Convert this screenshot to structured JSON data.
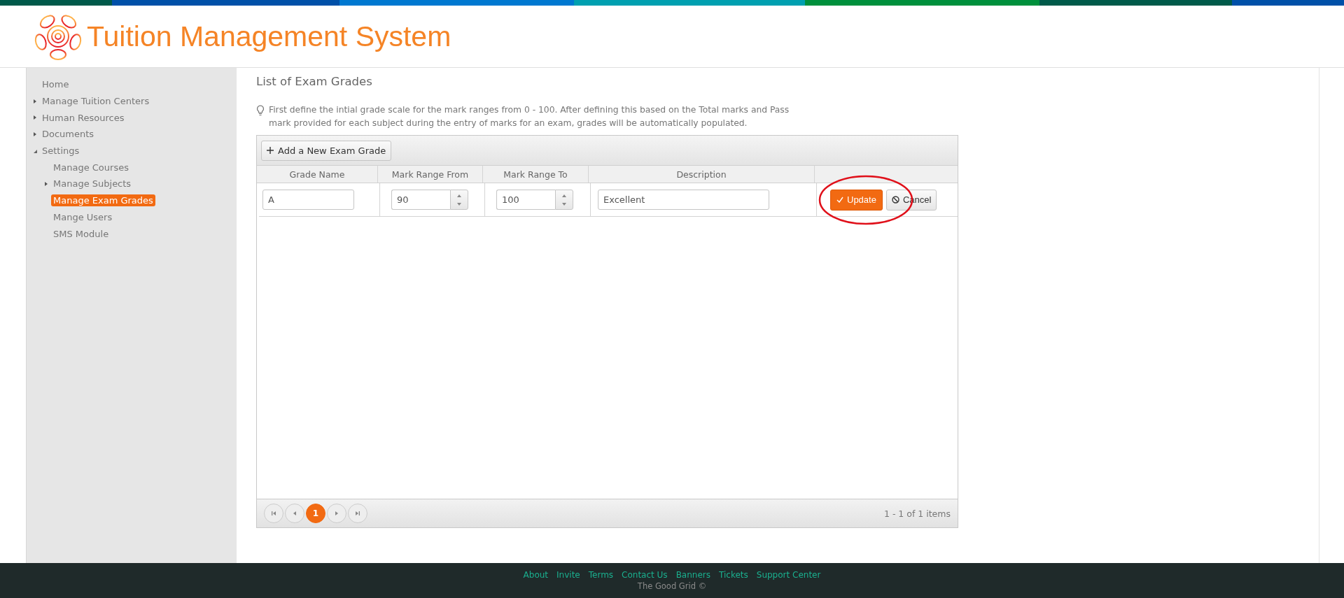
{
  "header": {
    "title": "Tuition Management System"
  },
  "sidebar": {
    "items": [
      {
        "label": "Home",
        "selected": false
      },
      {
        "label": "Manage Tuition Centers",
        "selected": false,
        "expanded": false
      },
      {
        "label": "Human Resources",
        "selected": false,
        "expanded": false
      },
      {
        "label": "Documents",
        "selected": false,
        "expanded": false
      },
      {
        "label": "Settings",
        "selected": false,
        "expanded": true,
        "children": [
          {
            "label": "Manage Courses",
            "selected": false
          },
          {
            "label": "Manage Subjects",
            "selected": false,
            "expanded": false
          },
          {
            "label": "Manage Exam Grades",
            "selected": true
          },
          {
            "label": "Mange Users",
            "selected": false
          },
          {
            "label": "SMS Module",
            "selected": false
          }
        ]
      }
    ]
  },
  "page_title": "List of Exam Grades",
  "hint": "First define the intial grade scale for the mark ranges from 0 - 100. After defining this based on the Total marks and Pass mark provided for each subject during the entry of marks for an exam, grades will be automatically populated.",
  "grid": {
    "toolbar_button": "Add a New Exam Grade",
    "columns": [
      "Grade Name",
      "Mark Range From",
      "Mark Range To",
      "Description"
    ],
    "edit_row": {
      "grade_name": "A",
      "from": "90",
      "to": "100",
      "description": "Excellent",
      "update": "Update",
      "cancel": "Cancel"
    },
    "pager": {
      "pages": [
        {
          "label": "1",
          "selected": true
        }
      ],
      "info": "1 - 1 of 1 items"
    }
  },
  "footer": {
    "links": [
      "About",
      "Invite",
      "Terms",
      "Contact Us",
      "Banners",
      "Tickets",
      "Support Center"
    ],
    "copyright": "The Good Grid ©"
  }
}
